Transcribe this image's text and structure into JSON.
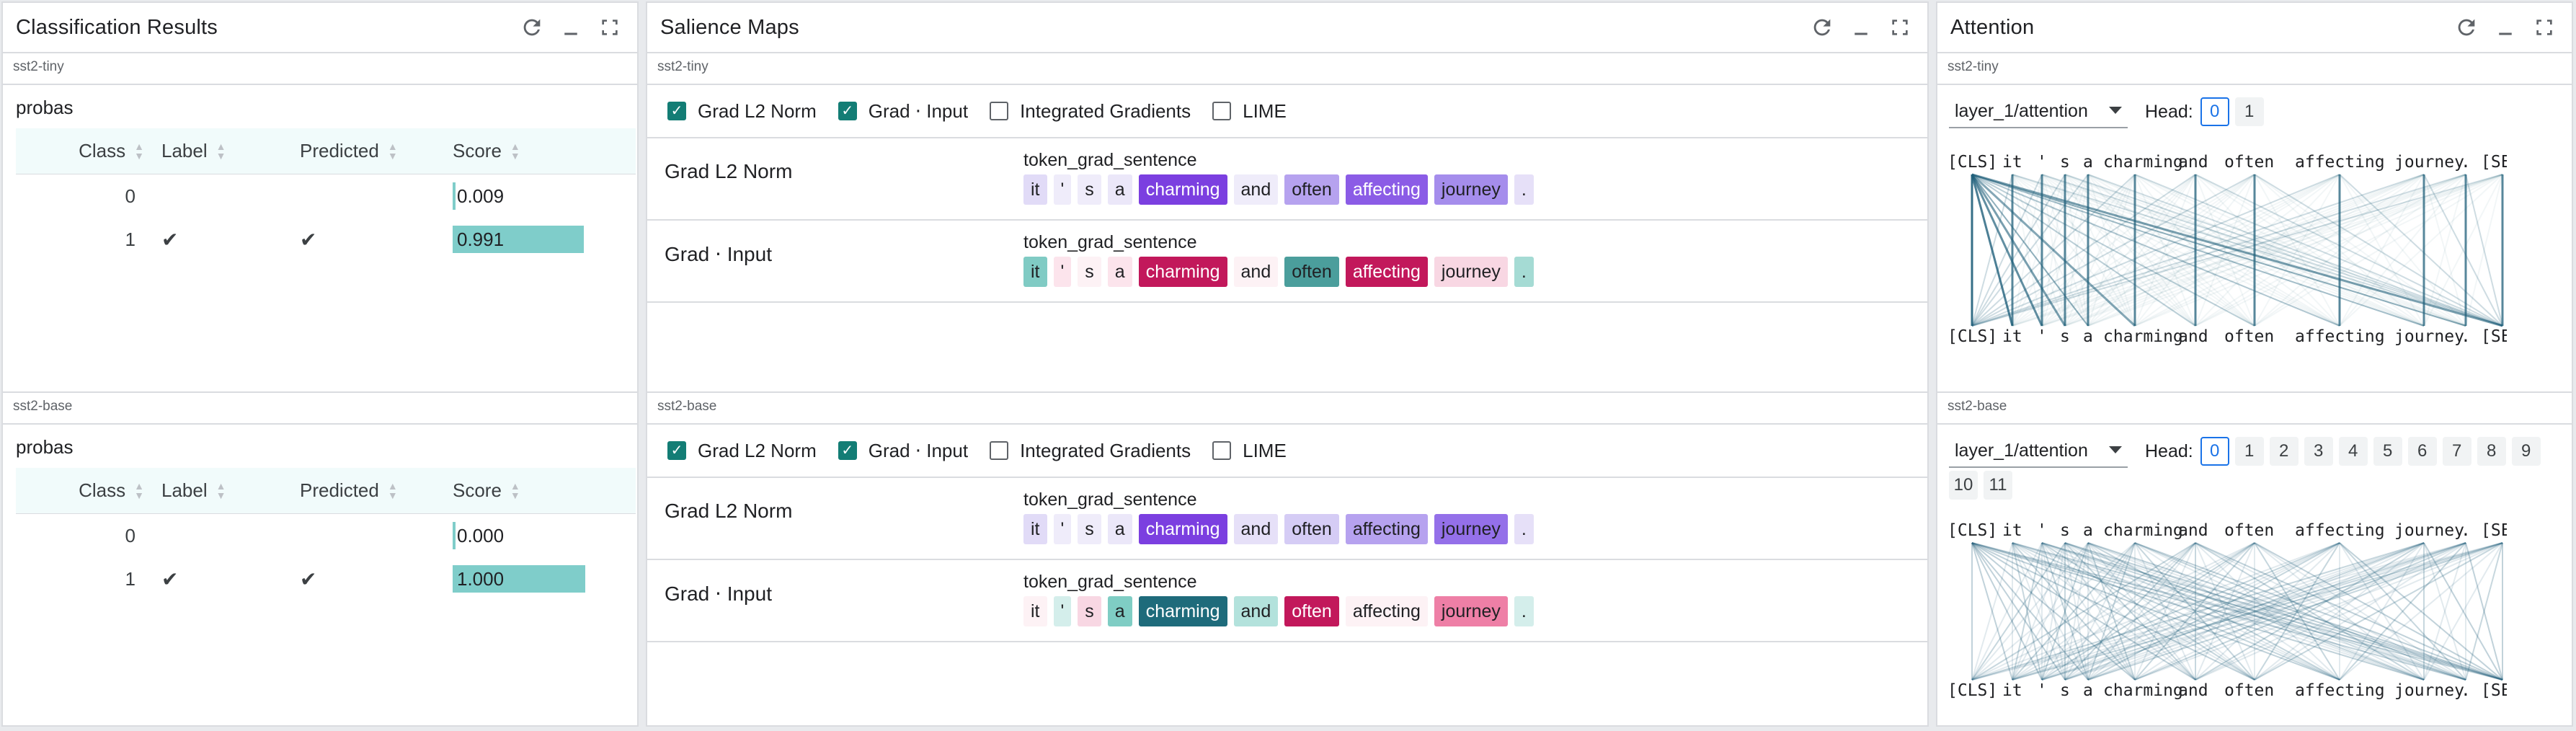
{
  "modules": {
    "classification": {
      "title": "Classification Results"
    },
    "salience": {
      "title": "Salience Maps"
    },
    "attention": {
      "title": "Attention"
    }
  },
  "models": [
    "sst2-tiny",
    "sst2-base"
  ],
  "classification": {
    "probas_label": "probas",
    "columns": [
      "Class",
      "Label",
      "Predicted",
      "Score"
    ],
    "tables": [
      {
        "rows": [
          {
            "class": "0",
            "label": "",
            "predicted": "",
            "score": "0.009",
            "score_value": 0.009
          },
          {
            "class": "1",
            "label": "✔",
            "predicted": "✔",
            "score": "0.991",
            "score_value": 0.991
          }
        ]
      },
      {
        "rows": [
          {
            "class": "0",
            "label": "",
            "predicted": "",
            "score": "0.000",
            "score_value": 0.0
          },
          {
            "class": "1",
            "label": "✔",
            "predicted": "✔",
            "score": "1.000",
            "score_value": 1.0
          }
        ]
      }
    ],
    "bar_color": "#7fcdca"
  },
  "salience": {
    "methods": [
      {
        "label": "Grad L2 Norm",
        "checked": true
      },
      {
        "label": "Grad ⋅ Input",
        "checked": true
      },
      {
        "label": "Integrated Gradients",
        "checked": false
      },
      {
        "label": "LIME",
        "checked": false
      }
    ],
    "field": "token_grad_sentence",
    "tokens": [
      "it",
      "'",
      "s",
      "a",
      "charming",
      "and",
      "often",
      "affecting",
      "journey",
      "."
    ],
    "models": [
      {
        "rows": [
          {
            "name": "Grad L2 Norm",
            "colors": [
              "#e1dbf7",
              "#efecfa",
              "#efecfa",
              "#ebe7f9",
              "#7b3fe0",
              "#efecfa",
              "#b6a2ef",
              "#8b5ce6",
              "#a58dec",
              "#e6e0f8"
            ],
            "text": [
              "#202124",
              "#202124",
              "#202124",
              "#202124",
              "#ffffff",
              "#202124",
              "#202124",
              "#ffffff",
              "#202124",
              "#202124"
            ]
          },
          {
            "name": "Grad ⋅ Input",
            "colors": [
              "#80cbc4",
              "#fce4ec",
              "#fdf2f5",
              "#fce4ec",
              "#c2185b",
              "#fdf2f5",
              "#4b9e9c",
              "#c2185b",
              "#f8d7e3",
              "#a5dbd4"
            ],
            "text": [
              "#202124",
              "#202124",
              "#202124",
              "#202124",
              "#ffffff",
              "#202124",
              "#202124",
              "#ffffff",
              "#202124",
              "#202124"
            ]
          }
        ]
      },
      {
        "rows": [
          {
            "name": "Grad L2 Norm",
            "colors": [
              "#e1dbf7",
              "#efecfa",
              "#efecfa",
              "#ebe7f9",
              "#7b3fe0",
              "#e6e0f8",
              "#d5ccf5",
              "#b6a2ef",
              "#9470e9",
              "#e6e0f8"
            ],
            "text": [
              "#202124",
              "#202124",
              "#202124",
              "#202124",
              "#ffffff",
              "#202124",
              "#202124",
              "#202124",
              "#202124",
              "#202124"
            ]
          },
          {
            "name": "Grad ⋅ Input",
            "colors": [
              "#fdf2f5",
              "#d4eeeb",
              "#f8d7e3",
              "#7fcdc4",
              "#1e6b7b",
              "#b3e2dc",
              "#c2185b",
              "#fdf2f5",
              "#ee7fa6",
              "#d4eeeb"
            ],
            "text": [
              "#202124",
              "#202124",
              "#202124",
              "#202124",
              "#ffffff",
              "#202124",
              "#ffffff",
              "#202124",
              "#202124",
              "#202124"
            ]
          }
        ]
      }
    ]
  },
  "attention": {
    "head_label": "Head:",
    "line_color": "#1f5f7a",
    "tokens": [
      "[CLS]",
      "it",
      "'",
      "s",
      "a",
      "charming",
      "and",
      "often",
      "affecting",
      "journey",
      ".",
      "[SEP]"
    ],
    "models": [
      {
        "layer": "layer_1/attention",
        "heads": [
          "0",
          "1"
        ],
        "selected": "0"
      },
      {
        "layer": "layer_1/attention",
        "heads": [
          "0",
          "1",
          "2",
          "3",
          "4",
          "5",
          "6",
          "7",
          "8",
          "9",
          "10",
          "11"
        ],
        "selected": "0"
      }
    ]
  }
}
